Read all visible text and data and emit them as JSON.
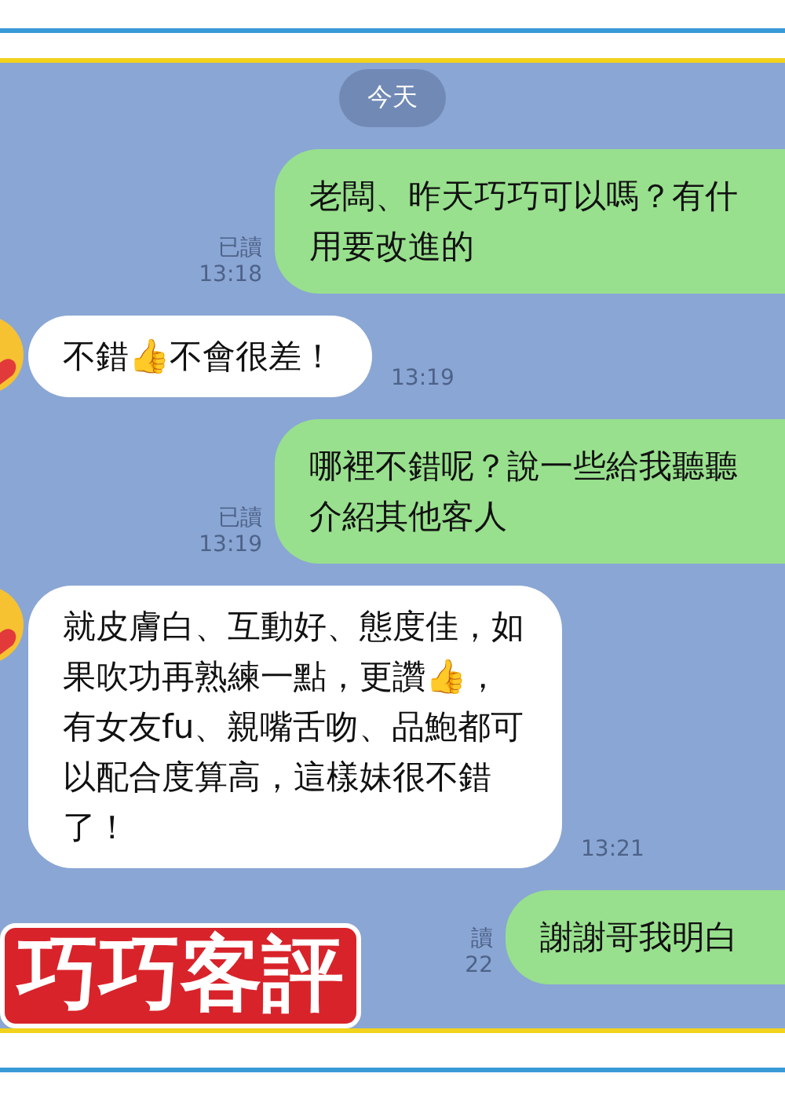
{
  "messages": [
    {
      "kind": "date",
      "text": "今天"
    },
    {
      "kind": "sent",
      "lines": [
        "老闆、昨天巧巧可以嗎？有什",
        "用要改進的"
      ],
      "read": "已讀",
      "time": "13:18"
    },
    {
      "kind": "received",
      "lines": [
        "不錯👍不會很差！"
      ],
      "time": "13:19"
    },
    {
      "kind": "sent",
      "lines": [
        "哪裡不錯呢？說一些給我聽聽",
        "介紹其他客人"
      ],
      "read": "已讀",
      "time": "13:19"
    },
    {
      "kind": "received",
      "lines": [
        "就皮膚白、互動好、態度佳，如",
        "果吹功再熟練一點，更讚👍，",
        "有女友fu、親嘴舌吻、品鮑都可",
        "以配合度算高，這樣妹很不錯",
        "了！"
      ],
      "time": "13:21"
    },
    {
      "kind": "sent",
      "lines": [
        "謝謝哥我明白"
      ],
      "read": "讀",
      "time": "22"
    }
  ],
  "overlay_title": "巧巧客評"
}
